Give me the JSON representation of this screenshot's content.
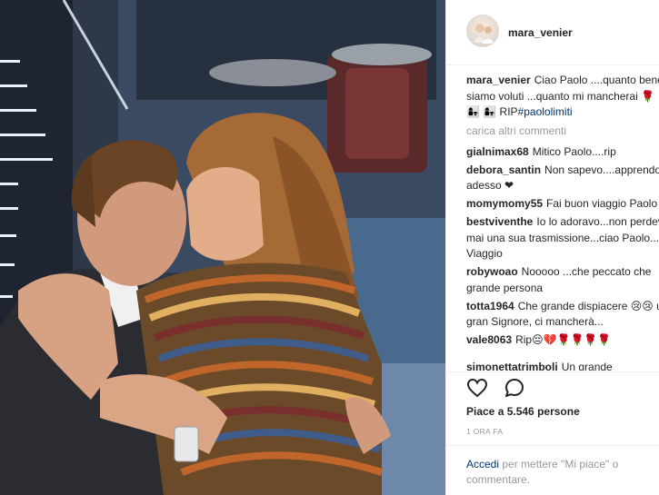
{
  "post": {
    "username": "mara_venier",
    "caption_user": "mara_venier",
    "caption_text": "Ciao Paolo ....quanto bene ci siamo voluti ...quanto mi mancherai 🌹",
    "caption_line2_prefix": "👩‍👧 👩‍👧 RIP",
    "caption_hashtag": "#paololimiti",
    "load_more": "carica altri commenti",
    "comments": [
      {
        "user": "gialnimax68",
        "text": "Mitico Paolo....rip"
      },
      {
        "user": "debora_santin",
        "text": "Non sapevo....apprendo solo adesso ❤"
      },
      {
        "user": "momymomy55",
        "text": "Fai buon viaggio Paolo"
      },
      {
        "user": "bestviventhe",
        "text": "Io lo adoravo...non perdevo mai una sua trasmissione...ciao Paolo...buon Viaggio"
      },
      {
        "user": "robywoao",
        "text": "Nooooo ...che peccato che grande persona"
      },
      {
        "user": "totta1964",
        "text": "Che grande dispiacere 😢😢 un gran Signore, ci mancherà..."
      },
      {
        "user": "vale8063",
        "text": "Rip😔💔🌹🌹🌹🌹"
      }
    ],
    "cut_comment": {
      "user": "simonettatrimboli",
      "text": "Un grande dispiacere"
    },
    "like_icon": "heart-icon",
    "comment_icon": "comment-icon",
    "likes": "Piace a 5.546 persone",
    "time": "1 ORA FA",
    "login_link": "Accedi",
    "login_text": " per mettere \"Mi piace\" o commentare."
  }
}
